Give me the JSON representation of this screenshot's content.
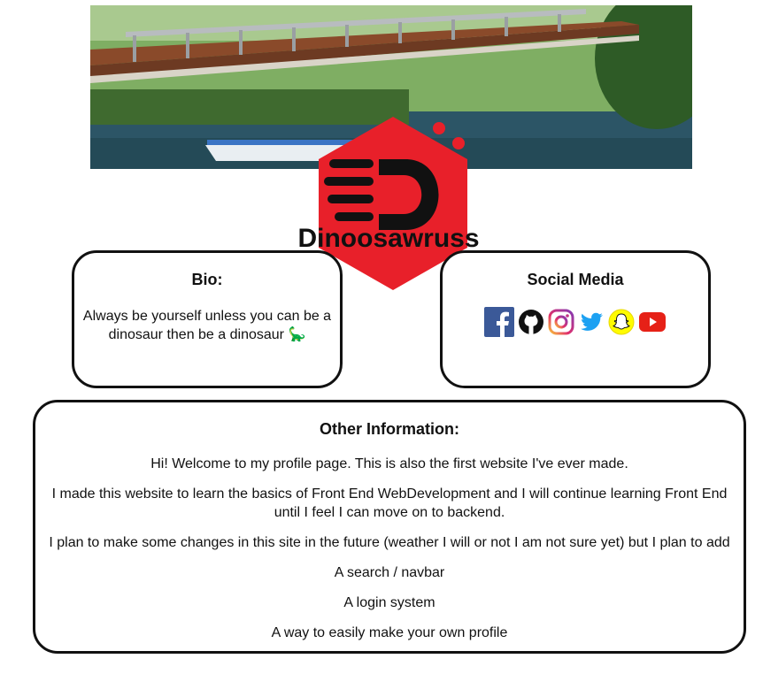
{
  "profile": {
    "username": "Dinoosawruss"
  },
  "bio": {
    "heading": "Bio:",
    "text": "Always be yourself unless you can be a dinosaur then be a dinosaur 🦕"
  },
  "social": {
    "heading": "Social Media",
    "icons": [
      "facebook-icon",
      "github-icon",
      "instagram-icon",
      "twitter-icon",
      "snapchat-icon",
      "youtube-icon"
    ]
  },
  "other": {
    "heading": "Other Information:",
    "paragraphs": [
      "Hi! Welcome to my profile page. This is also the first website I've ever made.",
      "I made this website to learn the basics of Front End WebDevelopment and I will continue learning Front End until I feel I can move on to backend.",
      "I plan to make some changes in this site in the future (weather I will or not I am not sure yet) but I plan to add",
      "A search / navbar",
      "A login system",
      "A way to easily make your own profile"
    ]
  },
  "colors": {
    "logo_red": "#e8202a",
    "border": "#111111"
  }
}
